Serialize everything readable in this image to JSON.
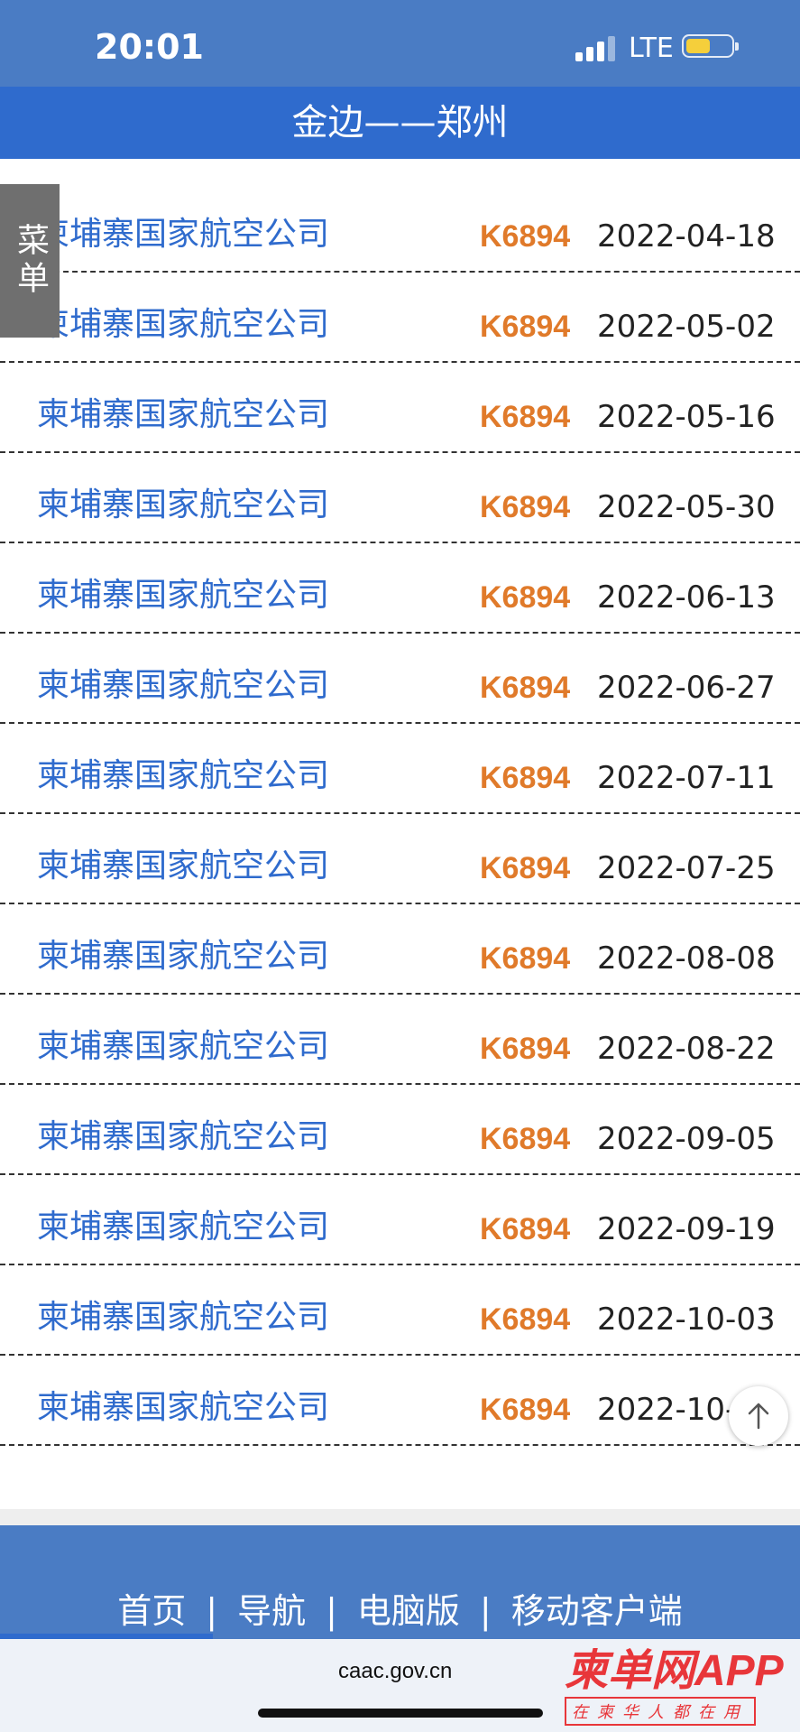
{
  "status_bar": {
    "time": "20:01",
    "network": "LTE",
    "battery_color": "#f5cf3b"
  },
  "header": {
    "title": "金边——郑州"
  },
  "menu_tab": {
    "label": "菜单"
  },
  "flights": [
    {
      "airline": "柬埔寨国家航空公司",
      "flight_no": "K6894",
      "date": "2022-04-18"
    },
    {
      "airline": "柬埔寨国家航空公司",
      "flight_no": "K6894",
      "date": "2022-05-02"
    },
    {
      "airline": "柬埔寨国家航空公司",
      "flight_no": "K6894",
      "date": "2022-05-16"
    },
    {
      "airline": "柬埔寨国家航空公司",
      "flight_no": "K6894",
      "date": "2022-05-30"
    },
    {
      "airline": "柬埔寨国家航空公司",
      "flight_no": "K6894",
      "date": "2022-06-13"
    },
    {
      "airline": "柬埔寨国家航空公司",
      "flight_no": "K6894",
      "date": "2022-06-27"
    },
    {
      "airline": "柬埔寨国家航空公司",
      "flight_no": "K6894",
      "date": "2022-07-11"
    },
    {
      "airline": "柬埔寨国家航空公司",
      "flight_no": "K6894",
      "date": "2022-07-25"
    },
    {
      "airline": "柬埔寨国家航空公司",
      "flight_no": "K6894",
      "date": "2022-08-08"
    },
    {
      "airline": "柬埔寨国家航空公司",
      "flight_no": "K6894",
      "date": "2022-08-22"
    },
    {
      "airline": "柬埔寨国家航空公司",
      "flight_no": "K6894",
      "date": "2022-09-05"
    },
    {
      "airline": "柬埔寨国家航空公司",
      "flight_no": "K6894",
      "date": "2022-09-19"
    },
    {
      "airline": "柬埔寨国家航空公司",
      "flight_no": "K6894",
      "date": "2022-10-03"
    },
    {
      "airline": "柬埔寨国家航空公司",
      "flight_no": "K6894",
      "date": "2022-10-"
    }
  ],
  "scroll_top": {
    "icon": "arrow-up-icon"
  },
  "footer": {
    "links": [
      "首页",
      "导航",
      "电脑版",
      "移动客户端"
    ],
    "separator": "|"
  },
  "browser": {
    "url": "caac.gov.cn"
  },
  "watermark": {
    "main": "柬单网APP",
    "sub": "在柬华人都在用"
  },
  "colors": {
    "header_bg": "#2f6bcd",
    "status_bg": "#4a7cc4",
    "airline_text": "#2f6bcd",
    "flight_text": "#e07a2a"
  }
}
